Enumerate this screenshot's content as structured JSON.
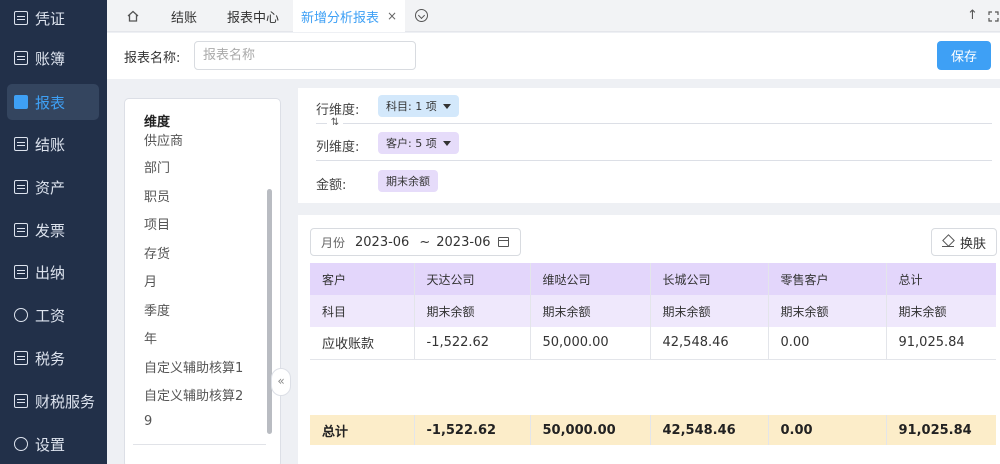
{
  "sidebar": {
    "items": [
      {
        "label": "凭证",
        "active": false
      },
      {
        "label": "账簿",
        "active": false
      },
      {
        "label": "报表",
        "active": true
      },
      {
        "label": "结账",
        "active": false
      },
      {
        "label": "资产",
        "active": false
      },
      {
        "label": "发票",
        "active": false
      },
      {
        "label": "出纳",
        "active": false
      },
      {
        "label": "工资",
        "active": false
      },
      {
        "label": "税务",
        "active": false
      },
      {
        "label": "财税服务",
        "active": false
      },
      {
        "label": "设置",
        "active": false
      }
    ]
  },
  "tabs": {
    "items": [
      {
        "label": "结账"
      },
      {
        "label": "报表中心"
      },
      {
        "label": "新增分析报表",
        "active": true
      }
    ],
    "close": "×"
  },
  "header": {
    "name_label": "报表名称:",
    "name_placeholder": "报表名称",
    "save_label": "保存"
  },
  "dimensions": {
    "title": "维度",
    "items": [
      "供应商",
      "部门",
      "职员",
      "项目",
      "存货",
      "月",
      "季度",
      "年",
      "自定义辅助核算1",
      "自定义辅助核算2",
      "9"
    ]
  },
  "config": {
    "row_label": "行维度:",
    "row_chip": "科目: 1 项",
    "col_label": "列维度:",
    "col_chip": "客户: 5 项",
    "amount_label": "金额:",
    "amount_chip": "期末余额",
    "swap_glyph": "⇅"
  },
  "filter": {
    "period_label": "月份",
    "start": "2023-06",
    "separator": "~",
    "end": "2023-06",
    "swap_label": "换肤"
  },
  "table": {
    "header1": [
      "客户",
      "天达公司",
      "维哒公司",
      "长城公司",
      "零售客户",
      "总计"
    ],
    "header2": [
      "科目",
      "期末余额",
      "期末余额",
      "期末余额",
      "期末余额",
      "期末余额"
    ],
    "rows": [
      [
        "应收账款",
        "-1,522.62",
        "50,000.00",
        "42,548.46",
        "0.00",
        "91,025.84"
      ]
    ],
    "total": [
      "总计",
      "-1,522.62",
      "50,000.00",
      "42,548.46",
      "0.00",
      "91,025.84"
    ]
  },
  "colors": {
    "accent": "#3ea0f5",
    "sidebar_bg": "#223049",
    "header_purple": "#e3d6fb",
    "total_row": "#fcedc9"
  }
}
